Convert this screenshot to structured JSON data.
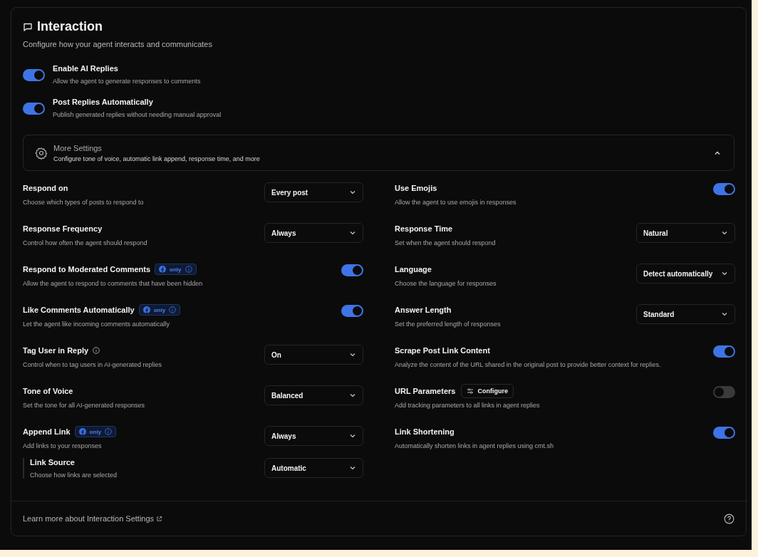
{
  "header": {
    "title": "Interaction",
    "subtitle": "Configure how your agent interacts and communicates"
  },
  "main_toggles": [
    {
      "label": "Enable AI Replies",
      "description": "Allow the agent to generate responses to comments",
      "on": true
    },
    {
      "label": "Post Replies Automatically",
      "description": "Publish generated replies without needing manual approval",
      "on": true
    }
  ],
  "more_settings": {
    "title": "More Settings",
    "description": "Configure tone of voice, automatic link append, response time, and more",
    "expanded": true
  },
  "left_settings": [
    {
      "kind": "select",
      "label": "Respond on",
      "description": "Choose which types of posts to respond to",
      "value": "Every post"
    },
    {
      "kind": "select",
      "label": "Response Frequency",
      "description": "Control how often the agent should respond",
      "value": "Always"
    },
    {
      "kind": "toggle",
      "label": "Respond to Moderated Comments",
      "badge": "only",
      "description": "Allow the agent to respond to comments that have been hidden",
      "on": true
    },
    {
      "kind": "toggle",
      "label": "Like Comments Automatically",
      "badge": "only",
      "description": "Let the agent like incoming comments automatically",
      "on": true
    },
    {
      "kind": "select",
      "label": "Tag User in Reply",
      "info": true,
      "description": "Control when to tag users in AI-generated replies",
      "value": "On"
    },
    {
      "kind": "select",
      "label": "Tone of Voice",
      "description": "Set the tone for all AI-generated responses",
      "value": "Balanced"
    },
    {
      "kind": "select",
      "label": "Append Link",
      "badge": "only",
      "description": "Add links to your responses",
      "value": "Always",
      "children": [
        {
          "kind": "select",
          "label": "Link Source",
          "description": "Choose how links are selected",
          "value": "Automatic"
        }
      ]
    }
  ],
  "right_settings": [
    {
      "kind": "toggle",
      "label": "Use Emojis",
      "description": "Allow the agent to use emojis in responses",
      "on": true
    },
    {
      "kind": "select",
      "label": "Response Time",
      "description": "Set when the agent should respond",
      "value": "Natural"
    },
    {
      "kind": "select",
      "label": "Language",
      "description": "Choose the language for responses",
      "value": "Detect automatically"
    },
    {
      "kind": "select",
      "label": "Answer Length",
      "description": "Set the preferred length of responses",
      "value": "Standard"
    },
    {
      "kind": "toggle",
      "label": "Scrape Post Link Content",
      "description": "Analyze the content of the URL shared in the original post to provide better context for replies.",
      "on": true
    },
    {
      "kind": "toggle",
      "label": "URL Parameters",
      "button": "Configure",
      "description": "Add tracking parameters to all links in agent replies",
      "on": false
    },
    {
      "kind": "toggle",
      "label": "Link Shortening",
      "description": "Automatically shorten links in agent replies using cmt.sh",
      "on": true
    }
  ],
  "footer": {
    "link": "Learn more about Interaction Settings"
  }
}
